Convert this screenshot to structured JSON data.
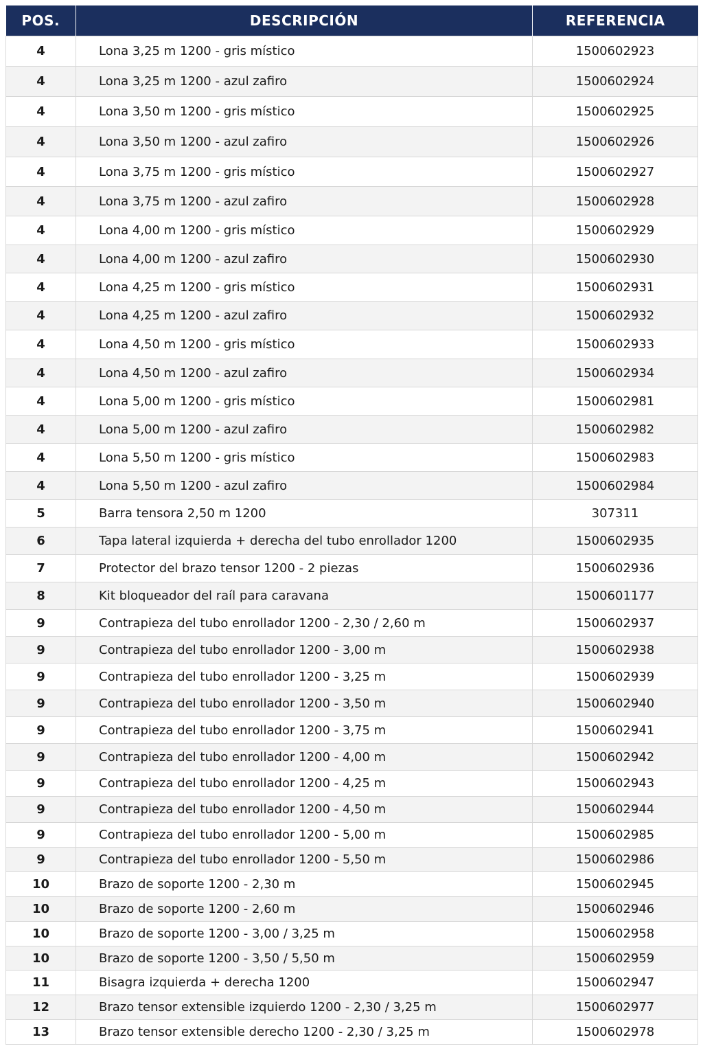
{
  "table": {
    "headers": [
      "POS.",
      "DESCRIPCIÓN",
      "REFERENCIA"
    ],
    "rows": [
      [
        "4",
        "Lona 3,25 m 1200 - gris místico",
        "1500602923"
      ],
      [
        "4",
        "Lona 3,25 m 1200 - azul zafiro",
        "1500602924"
      ],
      [
        "4",
        "Lona 3,50 m 1200 - gris místico",
        "1500602925"
      ],
      [
        "4",
        "Lona 3,50 m 1200 - azul zafiro",
        "1500602926"
      ],
      [
        "4",
        "Lona 3,75 m 1200 - gris místico",
        "1500602927"
      ],
      [
        "4",
        "Lona 3,75 m 1200 - azul zafiro",
        "1500602928"
      ],
      [
        "4",
        "Lona 4,00 m 1200 - gris místico",
        "1500602929"
      ],
      [
        "4",
        "Lona 4,00 m 1200 - azul zafiro",
        "1500602930"
      ],
      [
        "4",
        "Lona 4,25 m 1200 - gris místico",
        "1500602931"
      ],
      [
        "4",
        "Lona 4,25 m 1200 - azul zafiro",
        "1500602932"
      ],
      [
        "4",
        "Lona 4,50 m 1200 - gris místico",
        "1500602933"
      ],
      [
        "4",
        "Lona 4,50 m 1200 - azul zafiro",
        "1500602934"
      ],
      [
        "4",
        "Lona 5,00 m 1200 - gris místico",
        "1500602981"
      ],
      [
        "4",
        "Lona 5,00 m 1200 - azul zafiro",
        "1500602982"
      ],
      [
        "4",
        "Lona 5,50 m 1200 - gris místico",
        "1500602983"
      ],
      [
        "4",
        "Lona 5,50 m 1200 - azul zafiro",
        "1500602984"
      ],
      [
        "5",
        "Barra tensora 2,50 m 1200",
        "307311"
      ],
      [
        "6",
        "Tapa lateral izquierda + derecha del tubo enrollador 1200",
        "1500602935"
      ],
      [
        "7",
        "Protector del brazo tensor 1200 - 2 piezas",
        "1500602936"
      ],
      [
        "8",
        "Kit bloqueador del raíl para caravana",
        "1500601177"
      ],
      [
        "9",
        "Contrapieza del tubo enrollador 1200 - 2,30 / 2,60 m",
        "1500602937"
      ],
      [
        "9",
        "Contrapieza del tubo enrollador 1200 - 3,00 m",
        "1500602938"
      ],
      [
        "9",
        "Contrapieza del tubo enrollador 1200 - 3,25 m",
        "1500602939"
      ],
      [
        "9",
        "Contrapieza del tubo enrollador 1200 - 3,50 m",
        "1500602940"
      ],
      [
        "9",
        "Contrapieza del tubo enrollador 1200 - 3,75 m",
        "1500602941"
      ],
      [
        "9",
        "Contrapieza del tubo enrollador 1200 - 4,00 m",
        "1500602942"
      ],
      [
        "9",
        "Contrapieza del tubo enrollador 1200 - 4,25 m",
        "1500602943"
      ],
      [
        "9",
        "Contrapieza del tubo enrollador 1200 - 4,50 m",
        "1500602944"
      ],
      [
        "9",
        "Contrapieza del tubo enrollador 1200 - 5,00 m",
        "1500602985"
      ],
      [
        "9",
        "Contrapieza del tubo enrollador 1200 - 5,50 m",
        "1500602986"
      ],
      [
        "10",
        "Brazo de soporte 1200 - 2,30 m",
        "1500602945"
      ],
      [
        "10",
        "Brazo de soporte 1200 - 2,60 m",
        "1500602946"
      ],
      [
        "10",
        "Brazo de soporte 1200 - 3,00 / 3,25 m",
        "1500602958"
      ],
      [
        "10",
        "Brazo de soporte 1200 - 3,50 / 5,50 m",
        "1500602959"
      ],
      [
        "11",
        "Bisagra izquierda + derecha 1200",
        "1500602947"
      ],
      [
        "12",
        "Brazo tensor extensible izquierdo 1200 - 2,30 / 3,25 m",
        "1500602977"
      ],
      [
        "13",
        "Brazo tensor extensible derecho 1200 - 2,30 / 3,25 m",
        "1500602978"
      ]
    ]
  },
  "colors": {
    "header_bg": "#1b2f5e",
    "header_text": "#ffffff",
    "stripe": "#f3f3f3",
    "grid": "#d7d7d7"
  }
}
